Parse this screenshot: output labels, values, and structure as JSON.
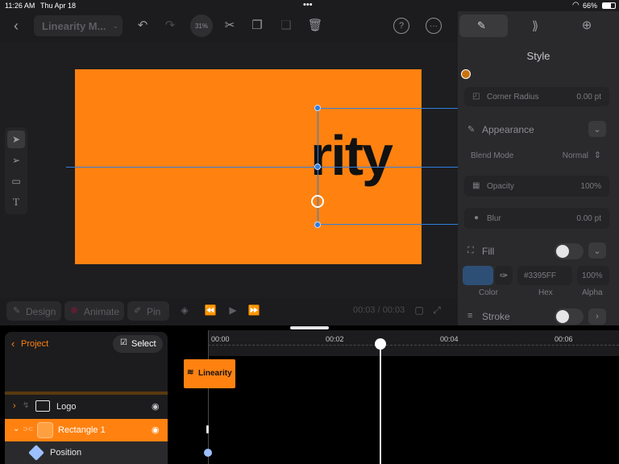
{
  "status": {
    "time": "11:26 AM",
    "date": "Thu Apr 18",
    "dots": "•••",
    "battery": "66%"
  },
  "toolbar": {
    "project_title": "Linearity M...",
    "zoom": "31%"
  },
  "canvas": {
    "artboard_text": "rity"
  },
  "panel": {
    "style_title": "Style",
    "corner_radius_label": "Corner Radius",
    "corner_radius_value": "0.00 pt",
    "appearance_label": "Appearance",
    "blend_mode_label": "Blend Mode",
    "blend_mode_value": "Normal",
    "opacity_label": "Opacity",
    "opacity_value": "100%",
    "blur_label": "Blur",
    "blur_value": "0.00 pt",
    "fill_label": "Fill",
    "fill_hex": "#3395FF",
    "fill_alpha": "100%",
    "col_color": "Color",
    "col_hex": "Hex",
    "col_alpha": "Alpha",
    "stroke_label": "Stroke"
  },
  "bottombar": {
    "design": "Design",
    "animate": "Animate",
    "pin": "Pin",
    "time": "00:03 / 00:03"
  },
  "timeline": {
    "project_label": "Project",
    "select_label": "Select",
    "ticks": [
      "00:00",
      "00:02",
      "00:04",
      "00:06"
    ],
    "clip_label": "Linearity",
    "layers": [
      {
        "name": "Logo"
      },
      {
        "name": "Rectangle 1"
      },
      {
        "name": "Position"
      }
    ]
  },
  "colors": {
    "accent": "#ff8211",
    "selection": "#2f7fe0",
    "fill_swatch": "#3395FF"
  }
}
